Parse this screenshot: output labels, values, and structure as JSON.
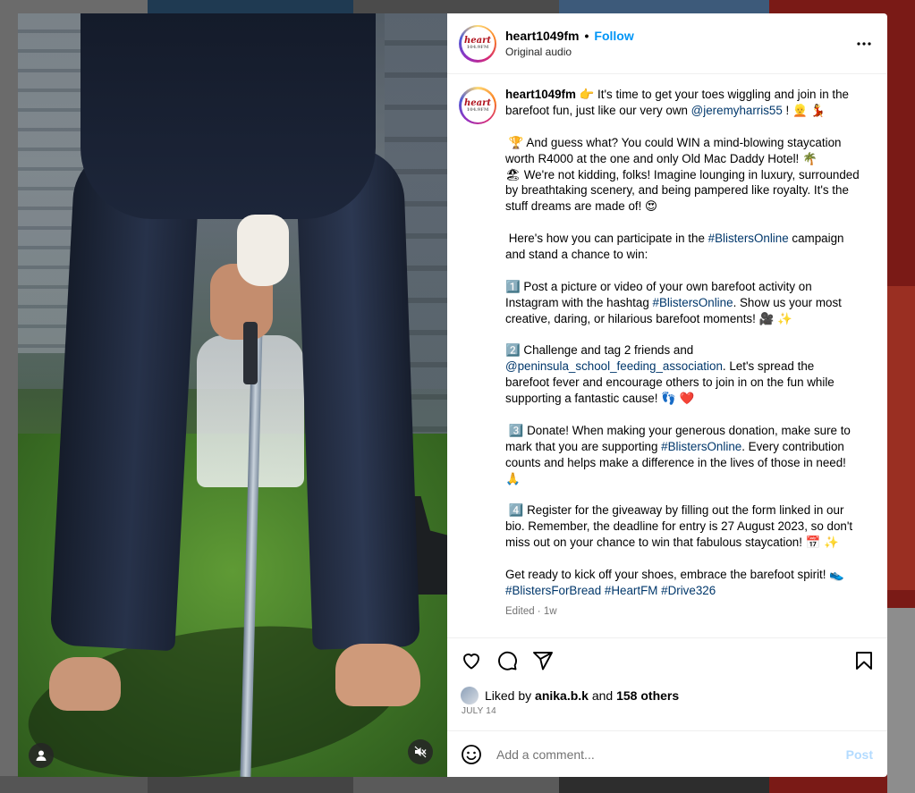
{
  "post": {
    "username": "heart1049fm",
    "follow_label": "Follow",
    "audio": "Original audio",
    "avatar_text": "heart",
    "avatar_subtext": "104.9FM"
  },
  "caption": {
    "username": "heart1049fm",
    "p1_a": "👉 It's time to get your toes wiggling and join in the barefoot fun, just like our very own ",
    "p1_link": "@jeremyharris55",
    "p1_b": " ! 👱 💃",
    "p2": " 🏆 And guess what? You could WIN a mind-blowing staycation worth R4000 at the one and only Old Mac Daddy Hotel! 🌴\n🏖 We're not kidding, folks! Imagine lounging in luxury, surrounded by breathtaking scenery, and being pampered like royalty. It's the stuff dreams are made of! 😍",
    "p3_a": " Here's how you can participate in the ",
    "p3_link": "#BlistersOnline",
    "p3_b": " campaign and stand a chance to win:",
    "p4_a": "1️⃣ Post a picture or video of your own barefoot activity on Instagram with the hashtag ",
    "p4_link": "#BlistersOnline",
    "p4_b": ". Show us your most creative, daring, or hilarious barefoot moments! 🎥 ✨",
    "p5_a": "2️⃣ Challenge and tag 2 friends and ",
    "p5_link": "@peninsula_school_feeding_association",
    "p5_b": ". Let's spread the barefoot fever and encourage others to join in on the fun while supporting a fantastic cause! 👣 ❤️",
    "p6_a": " 3️⃣ Donate! When making your generous donation, make sure to mark that you are supporting ",
    "p6_link": "#BlistersOnline",
    "p6_b": ". Every contribution counts and helps make a difference in the lives of those in need! 🙏",
    "p7": " 4️⃣ Register for the giveaway by filling out the form linked in our bio. Remember, the deadline for entry is 27 August 2023, so don't miss out on your chance to win that fabulous staycation! 📅 ✨",
    "p8_a": "Get ready to kick off your shoes, embrace the barefoot spirit! 👟\n",
    "p8_link": "#BlistersForBread #HeartFM #Drive326",
    "edited": "Edited · 1w"
  },
  "likes": {
    "prefix": "Liked by ",
    "user": "anika.b.k",
    "and": " and ",
    "others": "158 others"
  },
  "date": "JULY 14",
  "comment": {
    "placeholder": "Add a comment...",
    "post_label": "Post"
  },
  "icons": {
    "like": "heart-icon",
    "comment": "comment-icon",
    "share": "share-icon",
    "save": "bookmark-icon",
    "more": "more-icon",
    "emoji": "emoji-icon",
    "tagged_user": "user-icon",
    "mute": "mute-icon"
  }
}
